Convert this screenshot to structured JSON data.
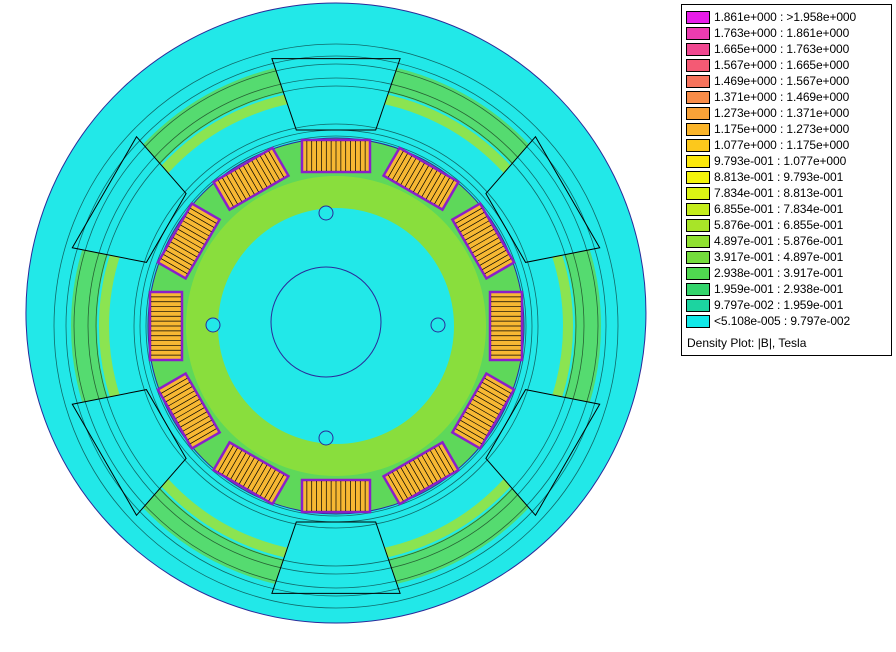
{
  "legend": {
    "entries": [
      {
        "label": "1.861e+000 : >1.958e+000",
        "color": "#e81ce8"
      },
      {
        "label": "1.763e+000 : 1.861e+000",
        "color": "#ec3cb0"
      },
      {
        "label": "1.665e+000 : 1.763e+000",
        "color": "#f04890"
      },
      {
        "label": "1.567e+000 : 1.665e+000",
        "color": "#f45a74"
      },
      {
        "label": "1.469e+000 : 1.567e+000",
        "color": "#f6735c"
      },
      {
        "label": "1.371e+000 : 1.469e+000",
        "color": "#f88c48"
      },
      {
        "label": "1.273e+000 : 1.371e+000",
        "color": "#f9a238"
      },
      {
        "label": "1.175e+000 : 1.273e+000",
        "color": "#fab42a"
      },
      {
        "label": "1.077e+000 : 1.175e+000",
        "color": "#fcc81c"
      },
      {
        "label": "9.793e-001 : 1.077e+000",
        "color": "#fce80c"
      },
      {
        "label": "8.813e-001 : 9.793e-001",
        "color": "#f4f40c"
      },
      {
        "label": "7.834e-001 : 8.813e-001",
        "color": "#dcf414"
      },
      {
        "label": "6.855e-001 : 7.834e-001",
        "color": "#c4ec1c"
      },
      {
        "label": "5.876e-001 : 6.855e-001",
        "color": "#a8e428"
      },
      {
        "label": "4.897e-001 : 5.876e-001",
        "color": "#90e030"
      },
      {
        "label": "3.917e-001 : 4.897e-001",
        "color": "#74dc3c"
      },
      {
        "label": "2.938e-001 : 3.917e-001",
        "color": "#50d850"
      },
      {
        "label": "1.959e-001 : 2.938e-001",
        "color": "#34d46c"
      },
      {
        "label": "9.797e-002 : 1.959e-001",
        "color": "#1cd4a0"
      },
      {
        "label": "<5.108e-005 : 9.797e-002",
        "color": "#10e8e8"
      }
    ],
    "caption": "Density Plot: |B|, Tesla"
  },
  "colors": {
    "background_field": "#22e8e8",
    "core_low": "#26e3d2",
    "core_mid": "#5ed85a",
    "core_high": "#a6e22a",
    "slot_fill": "#f7b833",
    "slot_edge": "#8a1fc9",
    "contour": "#000000",
    "outline": "#2a2a9a"
  }
}
